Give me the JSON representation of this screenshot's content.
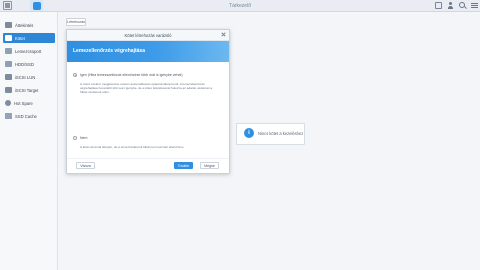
{
  "topbar": {
    "title": "Tárkezelő"
  },
  "sidebar": {
    "items": [
      {
        "label": "Áttekintés"
      },
      {
        "label": "Kötet"
      },
      {
        "label": "Lemezcsoport"
      },
      {
        "label": "HDD/SSD"
      },
      {
        "label": "iSCSI LUN"
      },
      {
        "label": "iSCSI Target"
      },
      {
        "label": "Hot Spare"
      },
      {
        "label": "SSD Cache"
      }
    ]
  },
  "toolbar": {
    "action_label": "Létrehozás"
  },
  "info": {
    "text": "Nincs kötet a kezeléshez"
  },
  "wizard": {
    "title": "Kötet létrehozás varázsló",
    "header": "Lemezellenőrzés végrehajtása",
    "options": [
      {
        "label": "Igen (Hiba lemezszektorok ellenőrzése több órát is igénybe vehet)",
        "description": "A rossz szektor megjelenése esetén automatikusan újraelosztásra kerül. A lemezellenőrzés végrehajtása hosszabb időt vesz igénybe, de a kötet felépítésénél fokozza az adatok védelmét a hibás szektorok ellen."
      },
      {
        "label": "Nem",
        "description": "A kötet azonnal létrejön, de a lemezszektorok hibái nem lesznek ellenőrizve."
      }
    ],
    "back_label": "Vissza",
    "next_label": "Tovább",
    "cancel_label": "Mégse"
  }
}
